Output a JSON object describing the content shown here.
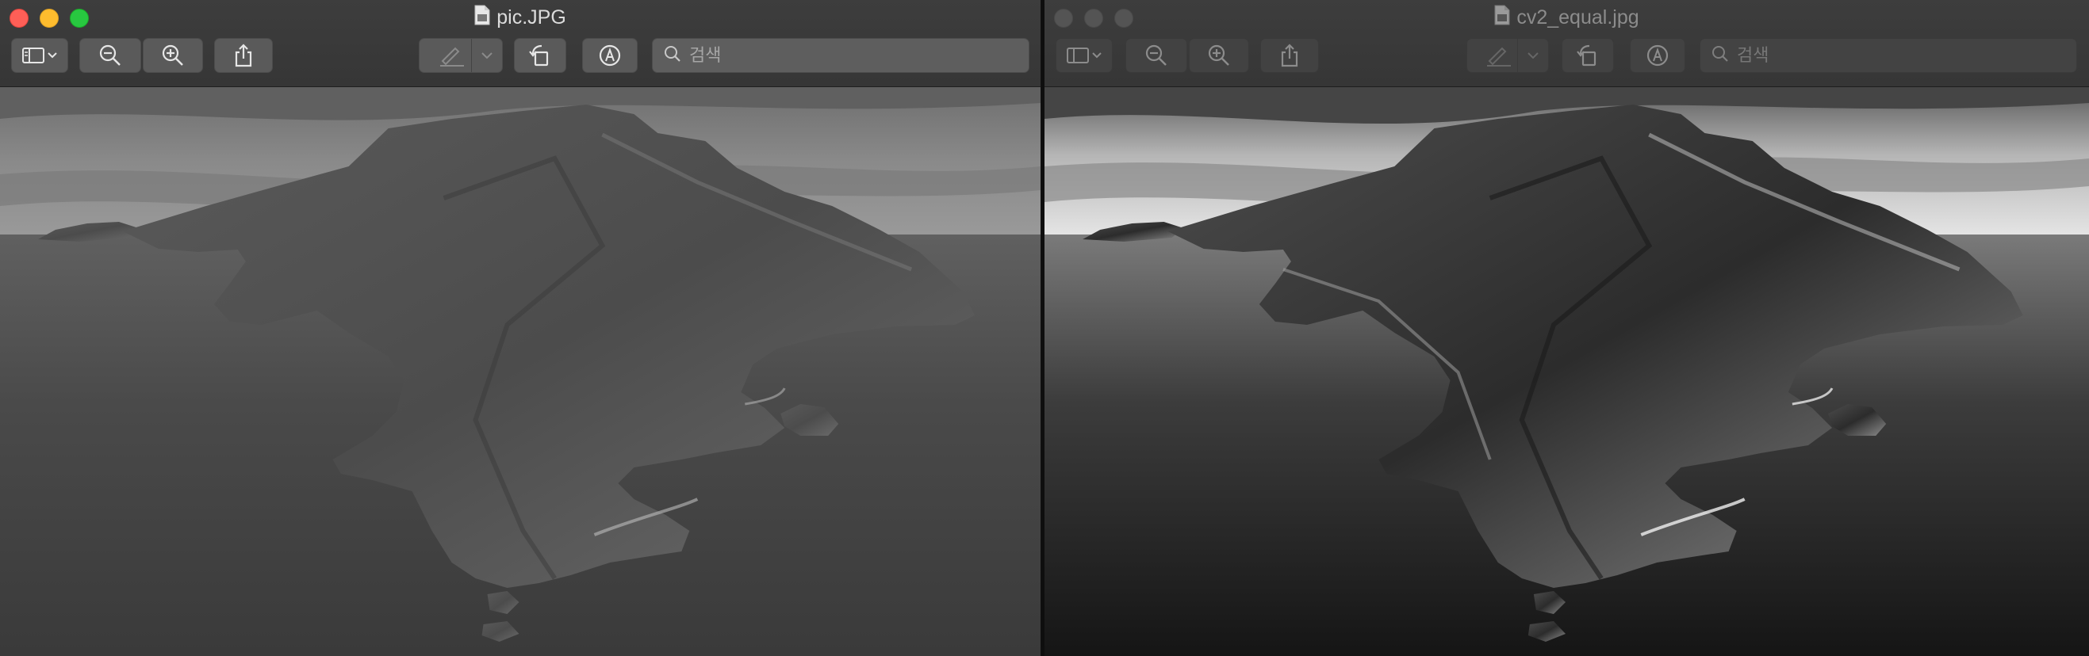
{
  "windows": [
    {
      "id": "left",
      "title": "pic.JPG",
      "active": true,
      "search": {
        "placeholder": "검색",
        "value": ""
      }
    },
    {
      "id": "right",
      "title": "cv2_equal.jpg",
      "active": false,
      "search": {
        "placeholder": "검색",
        "value": ""
      }
    }
  ],
  "icons": {
    "document": "document-icon",
    "sidebar": "sidebar-icon",
    "zoom_out": "zoom-out-icon",
    "zoom_in": "zoom-in-icon",
    "share": "share-icon",
    "markup_pen": "pen-icon",
    "rotate": "rotate-left-icon",
    "annotate": "markup-circle-icon",
    "search": "search-icon"
  },
  "colors": {
    "close": "#fe5f57",
    "minimize": "#febc2e",
    "maximize": "#28c840",
    "titlebar": "#3a3a3a"
  }
}
